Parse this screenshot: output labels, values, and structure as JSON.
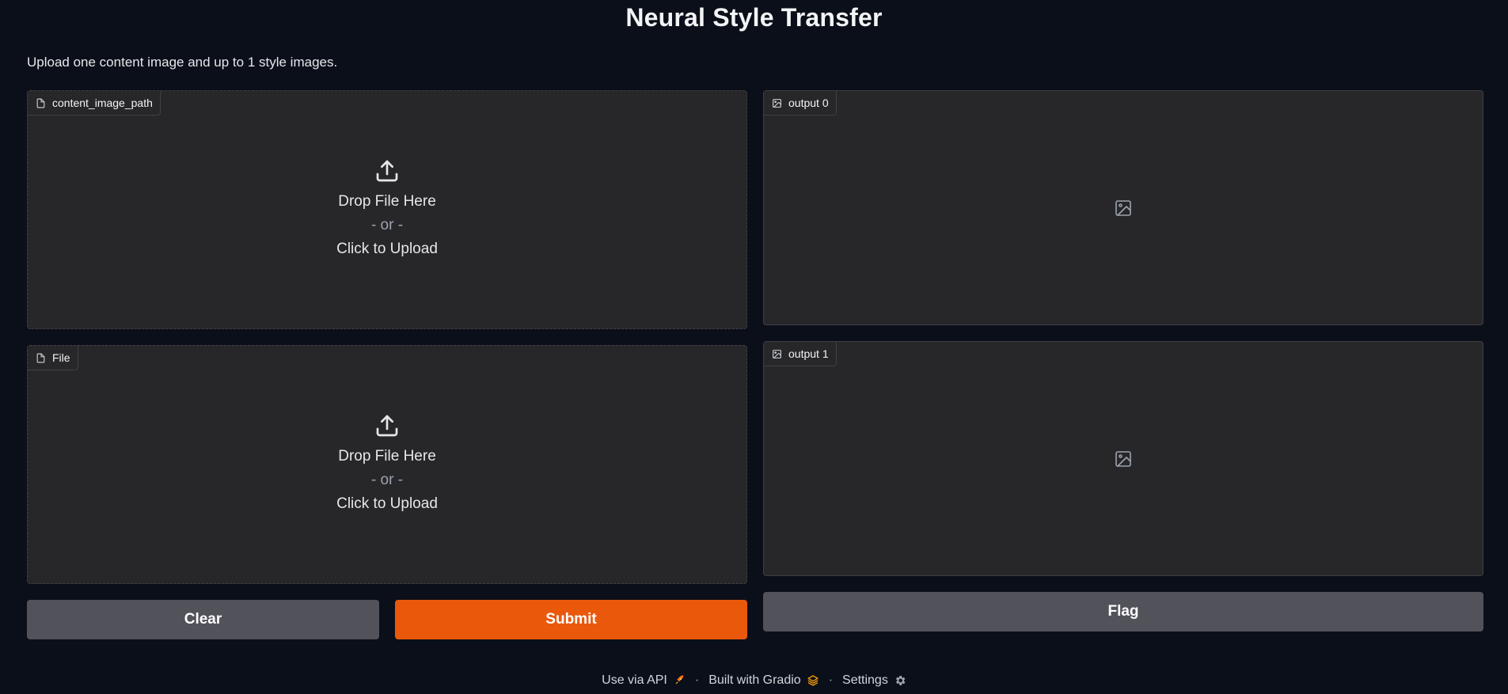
{
  "header": {
    "title": "Neural Style Transfer",
    "description": "Upload one content image and up to 1 style images."
  },
  "inputs": [
    {
      "label": "content_image_path",
      "drop_text": "Drop File Here",
      "or_text": "- or -",
      "click_text": "Click to Upload"
    },
    {
      "label": "File",
      "drop_text": "Drop File Here",
      "or_text": "- or -",
      "click_text": "Click to Upload"
    }
  ],
  "outputs": [
    {
      "label": "output 0"
    },
    {
      "label": "output 1"
    }
  ],
  "buttons": {
    "clear": "Clear",
    "submit": "Submit",
    "flag": "Flag"
  },
  "footer": {
    "api": "Use via API",
    "built": "Built with Gradio",
    "settings": "Settings",
    "separator": "·"
  },
  "colors": {
    "background": "#0b0f19",
    "panel": "#27272a",
    "primary": "#ea580c",
    "secondary": "#52525b"
  }
}
